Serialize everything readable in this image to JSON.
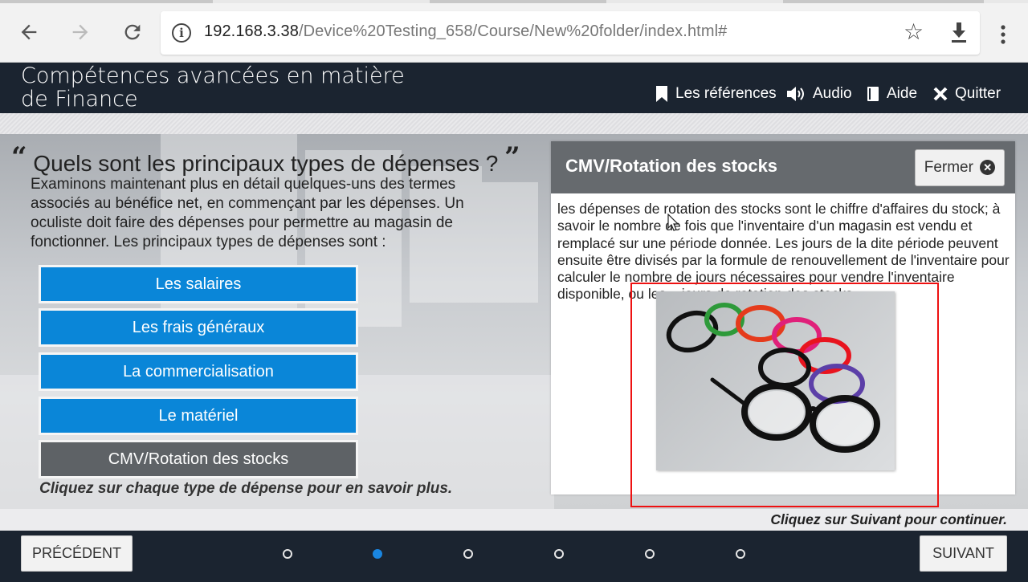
{
  "browser": {
    "url_host": "192.168.3.38",
    "url_path": "/Device%20Testing_658/Course/New%20folder/index.html#"
  },
  "header": {
    "title": "Compétences avancées en matière de Finance",
    "nav": [
      {
        "label": "Les références",
        "icon": "bookmark-icon"
      },
      {
        "label": "Audio",
        "icon": "speaker-icon"
      },
      {
        "label": "Aide",
        "icon": "book-icon"
      },
      {
        "label": "Quitter",
        "icon": "close-icon"
      }
    ]
  },
  "main": {
    "question": "Quels sont les principaux types de dépenses ?",
    "intro": "Examinons maintenant plus en détail quelques-uns des termes associés au bénéfice net, en commençant par les dépenses. Un oculiste doit faire des dépenses pour permettre au magasin de fonctionner. Les principaux types de dépenses sont :",
    "expense_buttons": [
      "Les salaires",
      "Les frais généraux",
      "La commercialisation",
      "Le matériel",
      "CMV/Rotation des stocks"
    ],
    "active_button": "CMV/Rotation des stocks",
    "hint": "Cliquez sur chaque type de dépense pour en savoir plus.",
    "next_hint": "Cliquez sur Suivant pour continuer."
  },
  "panel": {
    "title": "CMV/Rotation des stocks",
    "close_label": "Fermer",
    "text": "les dépenses de rotation des stocks sont le chiffre d'affaires du stock; à savoir le nombre de fois que l'inventaire d'un magasin est vendu et remplacé sur une période donnée. Les jours de la dite période peuvent ensuite être divisés par la formule de renouvellement de l'inventaire pour calculer le nombre de jours nécessaires pour vendre l'inventaire disponible, ou les « jours de rotation des stocks »."
  },
  "footer": {
    "prev_label": "PRÉCÉDENT",
    "next_label": "SUIVANT",
    "page_dots": 6,
    "active_dot": 2
  },
  "colors": {
    "header_bg": "#1b2430",
    "button_blue": "#0a86d8",
    "button_active": "#5e6266",
    "panel_head": "#666a6e",
    "highlight_red": "#ee1111"
  }
}
